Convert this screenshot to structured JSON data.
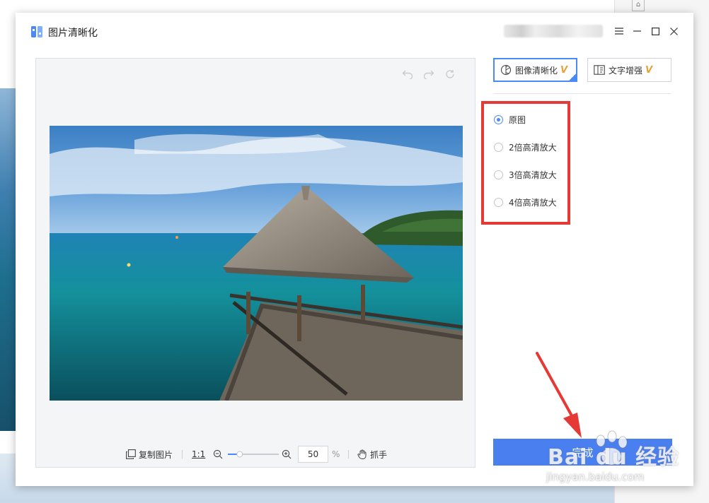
{
  "app": {
    "title": "图片清晰化",
    "logo_icon": "app-logo-icon",
    "user_name": "",
    "window_controls": [
      "menu-icon",
      "minimize-icon",
      "maximize-icon",
      "close-icon"
    ]
  },
  "preview": {
    "history_icons": [
      "undo-icon",
      "redo-icon",
      "refresh-icon"
    ],
    "toolbar": {
      "copy_label": "复制图片",
      "ratio_label": "1:1",
      "zoom_value": "50",
      "zoom_level": 0.5,
      "zoom_unit": "%",
      "hand_label": "抓手"
    }
  },
  "tabs": [
    {
      "label": "图像清晰化",
      "badge": "V",
      "icon": "image-enhance-icon",
      "active": true
    },
    {
      "label": "文字增强",
      "badge": "V",
      "icon": "text-enhance-icon",
      "active": false
    }
  ],
  "options": [
    {
      "label": "原图",
      "checked": true
    },
    {
      "label": "2倍高清放大",
      "checked": false
    },
    {
      "label": "3倍高清放大",
      "checked": false
    },
    {
      "label": "4倍高清放大",
      "checked": false
    }
  ],
  "done_label": "完成",
  "watermark": {
    "brand": "Bai du 经验",
    "url": "jingyan.baidu.com"
  },
  "colors": {
    "accent": "#4a7ff0",
    "highlight": "#e53935",
    "vip": "#e6a23c"
  }
}
